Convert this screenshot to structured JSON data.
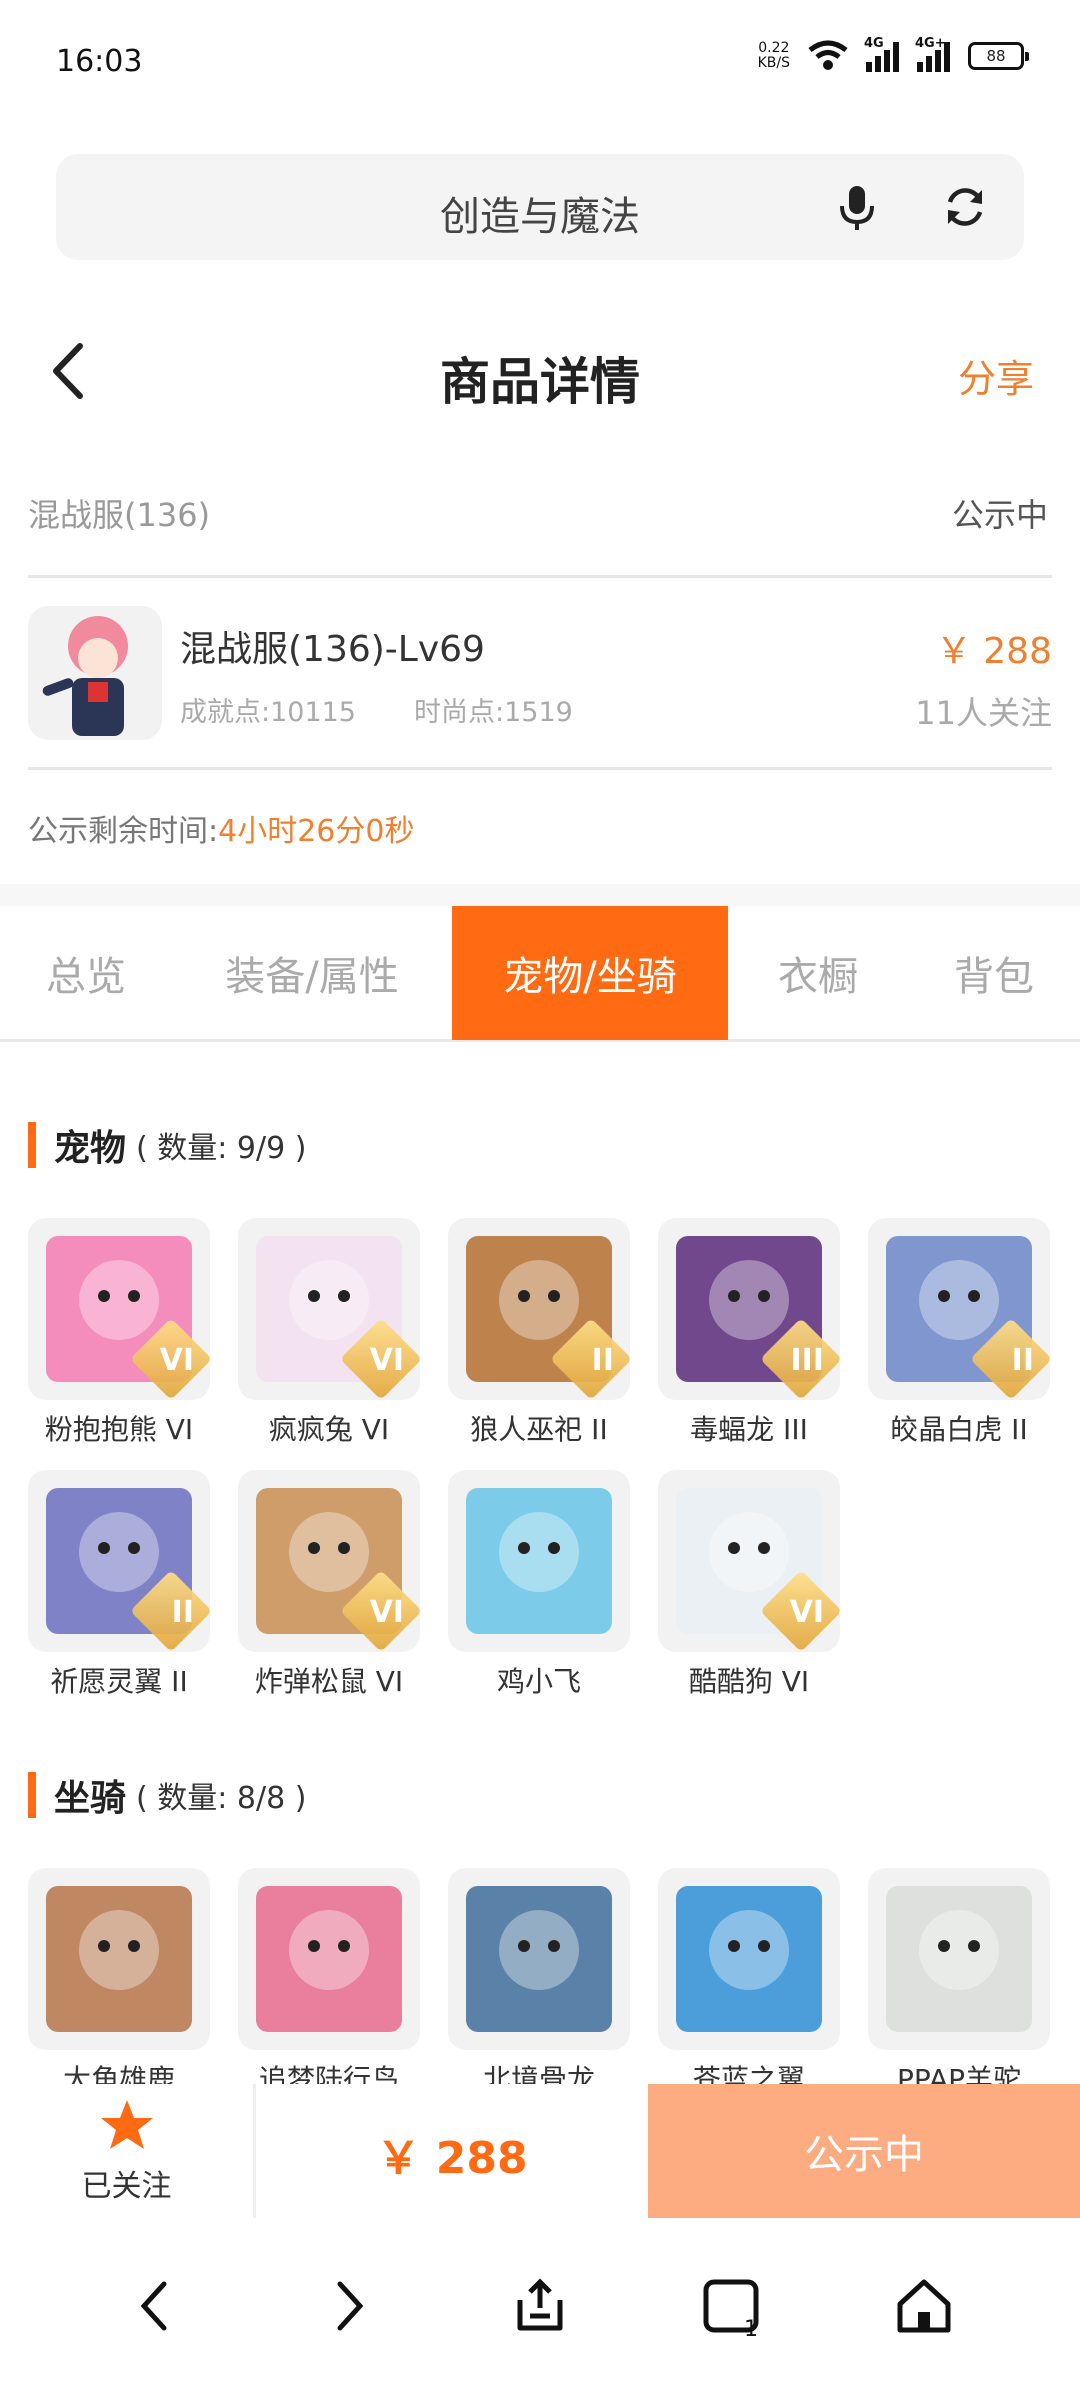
{
  "status_bar": {
    "time": "16:03",
    "net_speed_value": "0.22",
    "net_speed_unit": "KB/S",
    "sim1_type": "4G",
    "sim2_type": "4G+",
    "battery": "88"
  },
  "search": {
    "query": "创造与魔法"
  },
  "header": {
    "title": "商品详情",
    "share": "分享"
  },
  "server": {
    "name": "混战服(136)",
    "status": "公示中"
  },
  "product": {
    "name": "混战服(136)-Lv69",
    "achievement": "成就点:10115",
    "fashion": "时尚点:1519",
    "price": "￥ 288",
    "followers": "11人关注"
  },
  "remaining": {
    "label": "公示剩余时间:",
    "value": "4小时26分0秒"
  },
  "tabs": [
    {
      "label": "总览",
      "active": false
    },
    {
      "label": "装备/属性",
      "active": false
    },
    {
      "label": "宠物/坐骑",
      "active": true
    },
    {
      "label": "衣橱",
      "active": false
    },
    {
      "label": "背包",
      "active": false
    }
  ],
  "pets": {
    "title": "宠物",
    "count": "( 数量: 9/9 )",
    "items": [
      {
        "name": "粉抱抱熊 VI",
        "badge": "VI",
        "color": "#f47bb1"
      },
      {
        "name": "疯疯兔 VI",
        "badge": "VI",
        "color": "#f3dff0"
      },
      {
        "name": "狼人巫祀 II",
        "badge": "II",
        "color": "#b56f2f"
      },
      {
        "name": "毒蝠龙 III",
        "badge": "III",
        "color": "#5b2a7a"
      },
      {
        "name": "皎晶白虎 II",
        "badge": "II",
        "color": "#6b86c8"
      },
      {
        "name": "祈愿灵翼 II",
        "badge": "II",
        "color": "#6b6fc0"
      },
      {
        "name": "炸弹松鼠 VI",
        "badge": "VI",
        "color": "#c88e52"
      },
      {
        "name": "鸡小飞",
        "badge": "",
        "color": "#67c6e8"
      },
      {
        "name": "酷酷狗 VI",
        "badge": "VI",
        "color": "#eaf0f6"
      }
    ]
  },
  "mounts": {
    "title": "坐骑",
    "count": "( 数量: 8/8 )",
    "items": [
      {
        "name": "大角雄鹿",
        "color": "#b7744a"
      },
      {
        "name": "追梦陆行鸟",
        "color": "#e86a8e"
      },
      {
        "name": "北境骨龙",
        "color": "#3f6d9a"
      },
      {
        "name": "苍蓝之翼",
        "color": "#2f8fd6"
      },
      {
        "name": "PPAP羊驼",
        "color": "#d9ddd8"
      }
    ]
  },
  "action_bar": {
    "follow_label": "已关注",
    "price": "￥ 288",
    "status": "公示中"
  },
  "colors": {
    "accent": "#ff6a13",
    "accent_light": "#fdab80",
    "price": "#f07f2e"
  }
}
